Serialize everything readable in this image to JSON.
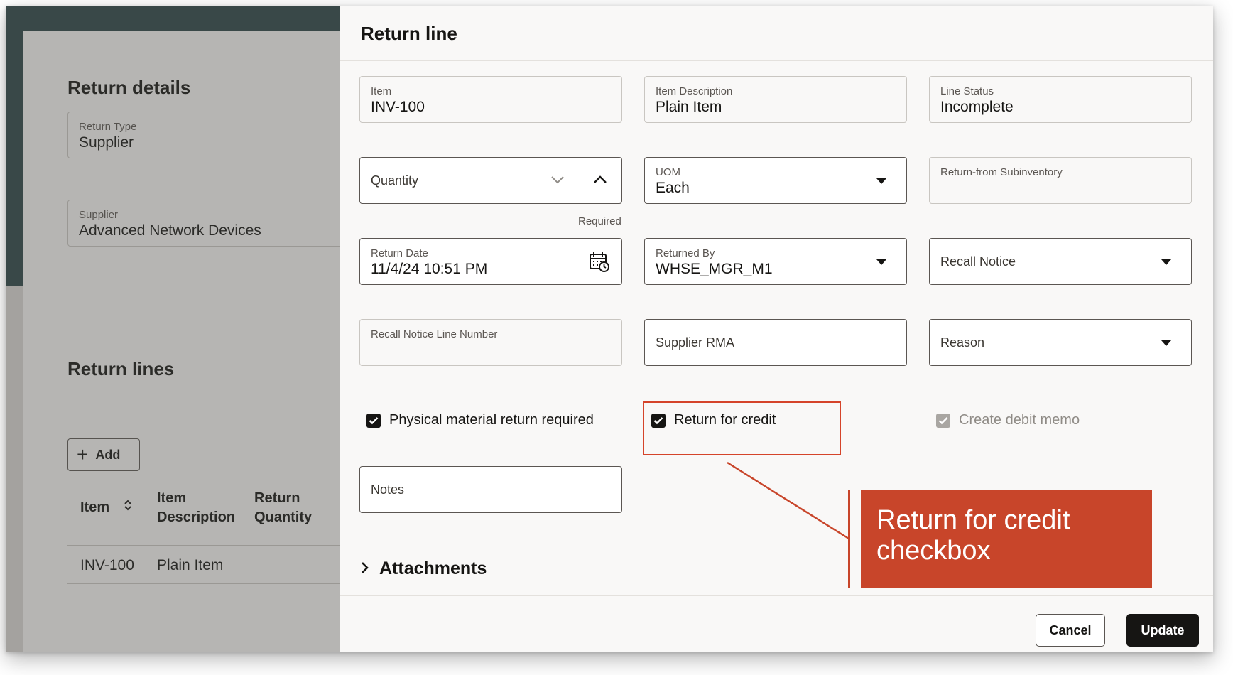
{
  "background_page": {
    "details_heading": "Return details",
    "return_type": {
      "label": "Return Type",
      "value": "Supplier"
    },
    "supplier": {
      "label": "Supplier",
      "value": "Advanced Network Devices"
    },
    "lines_heading": "Return lines",
    "add_label": "Add",
    "table": {
      "headers": [
        {
          "line1": "Item",
          "line2": ""
        },
        {
          "line1": "Item",
          "line2": "Description"
        },
        {
          "line1": "Return",
          "line2": "Quantity"
        }
      ],
      "rows": [
        {
          "item": "INV-100",
          "description": "Plain Item"
        }
      ]
    }
  },
  "dialog": {
    "title": "Return line",
    "item": {
      "label": "Item",
      "value": "INV-100"
    },
    "item_description": {
      "label": "Item Description",
      "value": "Plain Item"
    },
    "line_status": {
      "label": "Line Status",
      "value": "Incomplete"
    },
    "quantity": {
      "label": "Quantity",
      "required_text": "Required"
    },
    "uom": {
      "label": "UOM",
      "value": "Each"
    },
    "return_from_subinventory": {
      "label": "Return-from Subinventory"
    },
    "return_date": {
      "label": "Return Date",
      "value": "11/4/24 10:51 PM"
    },
    "returned_by": {
      "label": "Returned By",
      "value": "WHSE_MGR_M1"
    },
    "recall_notice": {
      "label": "Recall Notice"
    },
    "recall_notice_line": {
      "label": "Recall Notice Line Number"
    },
    "supplier_rma": {
      "label": "Supplier RMA"
    },
    "reason": {
      "label": "Reason"
    },
    "checkboxes": {
      "physical_return": {
        "label": "Physical material return required",
        "checked": true
      },
      "return_for_credit": {
        "label": "Return for credit",
        "checked": true
      },
      "create_debit_memo": {
        "label": "Create debit memo",
        "checked": true,
        "disabled": true
      }
    },
    "notes": {
      "label": "Notes"
    },
    "attachments_label": "Attachments",
    "cancel_label": "Cancel",
    "update_label": "Update"
  },
  "annotation": {
    "callout_text": "Return for credit checkbox",
    "color": "#c8452a"
  }
}
